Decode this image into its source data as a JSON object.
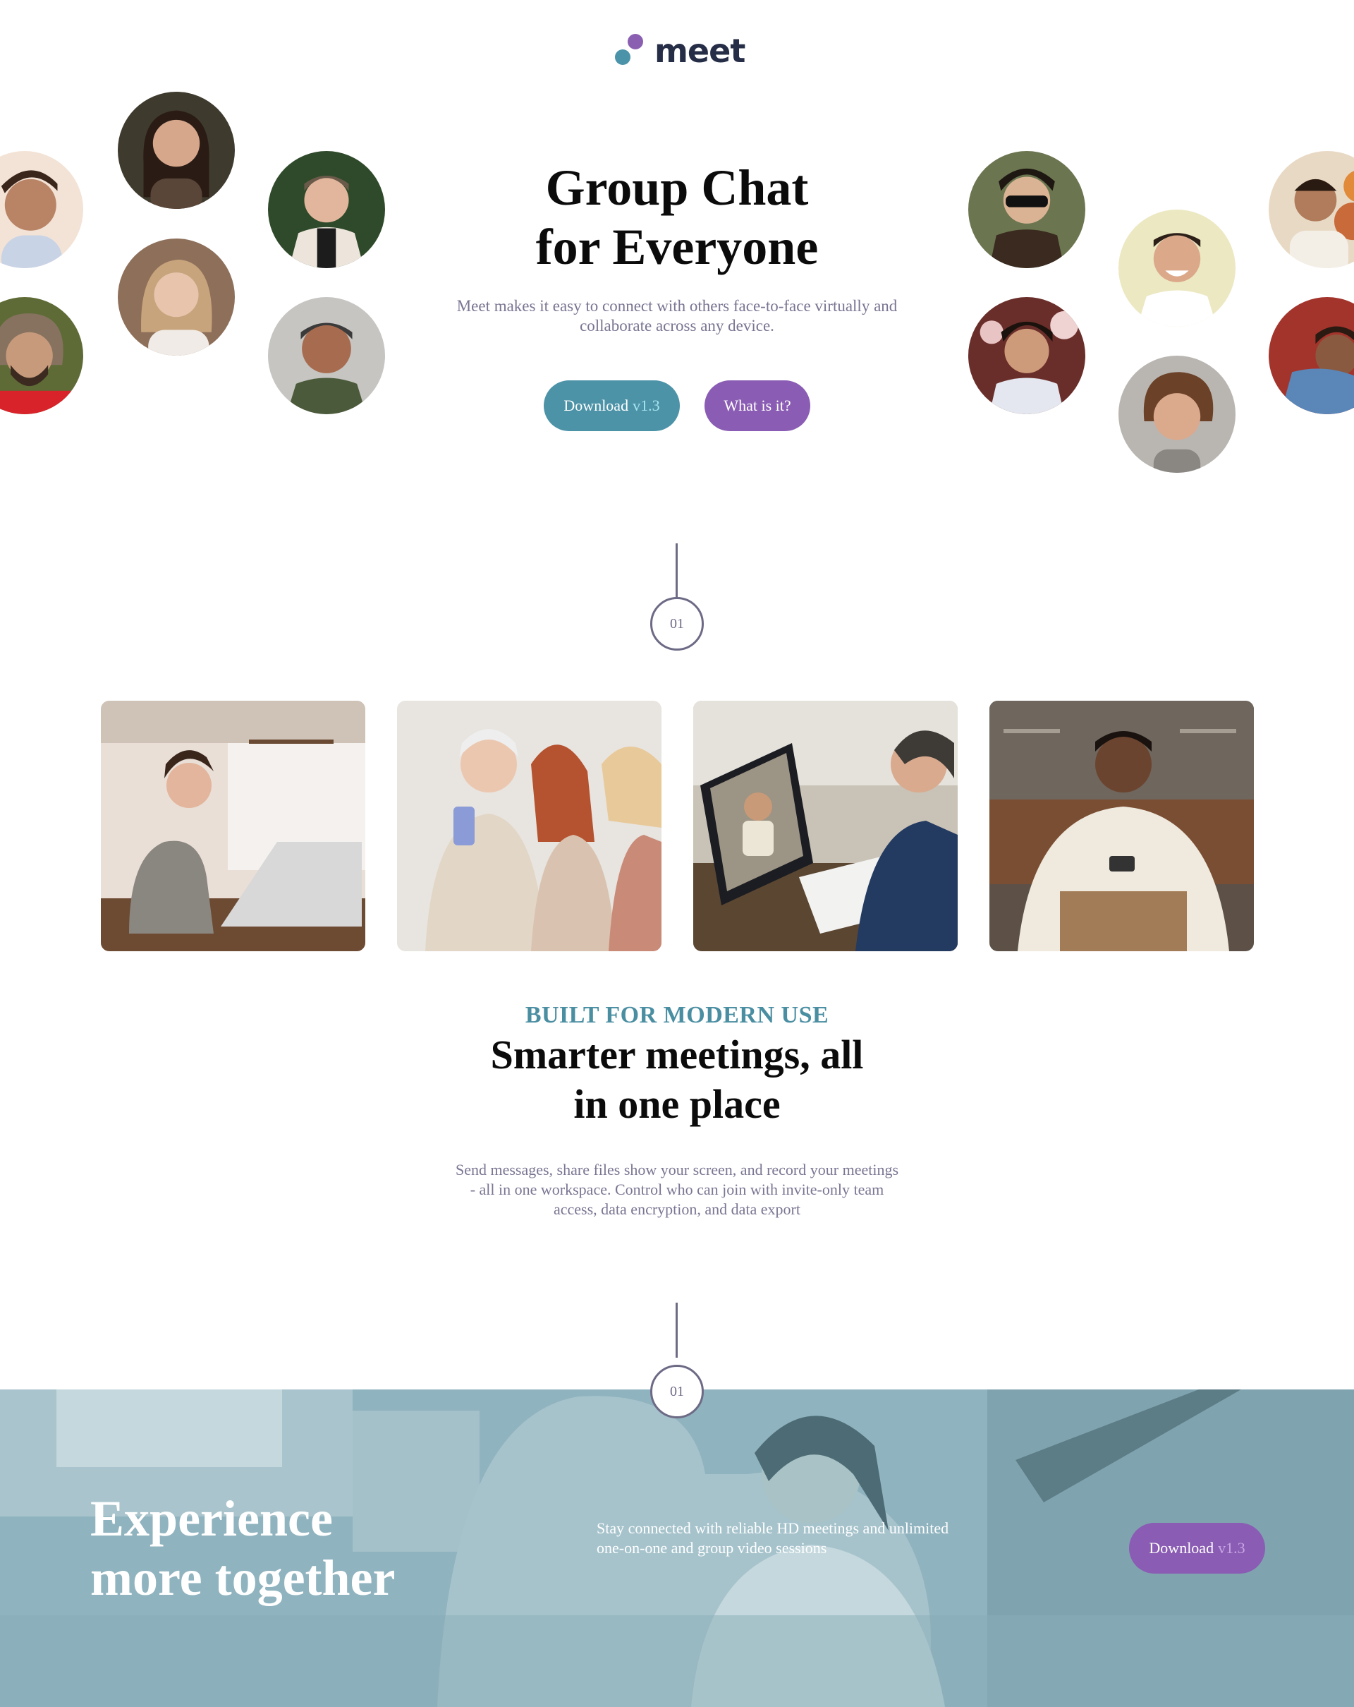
{
  "brand": {
    "name": "meet",
    "colors": {
      "teal": "#4c93a8",
      "purple": "#8a5cb3",
      "navy": "#262d46",
      "muted": "#7a7592"
    }
  },
  "hero": {
    "title_line1": "Group Chat",
    "title_line2": "for Everyone",
    "subtitle": "Meet makes it easy to connect with others face-to-face virtually and collaborate across any device.",
    "download_label": "Download",
    "download_version": "v1.3",
    "what_label": "What is it?"
  },
  "steps": {
    "first": "01",
    "second": "01"
  },
  "features": {
    "eyebrow": "BUILT FOR MODERN USE",
    "title_line1": "Smarter meetings, all",
    "title_line2": "in one place",
    "subtitle": "Send messages, share files show your screen, and record your meetings - all in one workspace. Control who can join with invite-only team access, data encryption, and data export"
  },
  "banner": {
    "title_line1": "Experience",
    "title_line2": "more together",
    "subtitle": "Stay connected with reliable HD meetings and unlimited one-on-one and group video sessions",
    "download_label": "Download",
    "download_version": "v1.3"
  }
}
